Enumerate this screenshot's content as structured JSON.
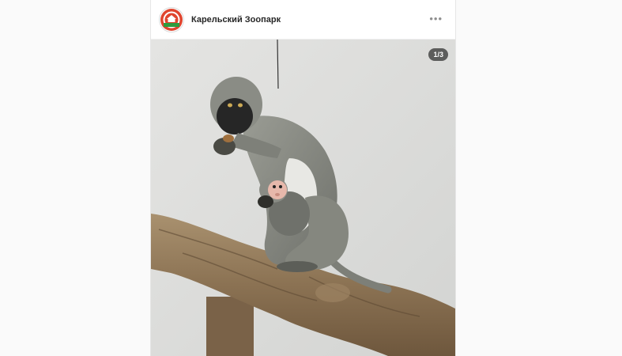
{
  "post": {
    "username": "Карельский Зоопарк",
    "more_icon": "more-horizontal-icon",
    "avatar_icon": "zoo-logo-icon",
    "carousel_counter": "1/3",
    "photo_subject": "monkey-with-baby-on-branch"
  },
  "colors": {
    "logo_red": "#e0452e",
    "logo_green": "#2e9c3e",
    "background": "#fafafa"
  }
}
